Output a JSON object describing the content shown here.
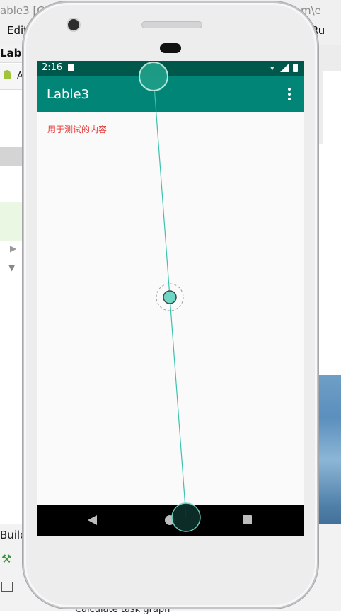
{
  "ide": {
    "title_fragment": "able3 [C",
    "title_fragment_right": "m\\e",
    "menu_edit": "Edit",
    "menu_run": "Ru",
    "project_label": "Lable",
    "android_label": "A",
    "build_label": "Build",
    "bottom_text": "Calculate task graph"
  },
  "phone": {
    "status_bar": {
      "time": "2:16"
    },
    "app_bar": {
      "title": "Lable3",
      "menu_icon": "overflow-menu-icon"
    },
    "content": {
      "text": "用于测试的内容"
    },
    "nav_bar": {
      "back_icon": "back-icon",
      "home_icon": "home-icon",
      "recents_icon": "recents-icon"
    }
  },
  "colors": {
    "status_bar": "#00574b",
    "app_bar": "#008577",
    "content_text": "#e53935",
    "gesture_accent": "#2bb39e"
  }
}
